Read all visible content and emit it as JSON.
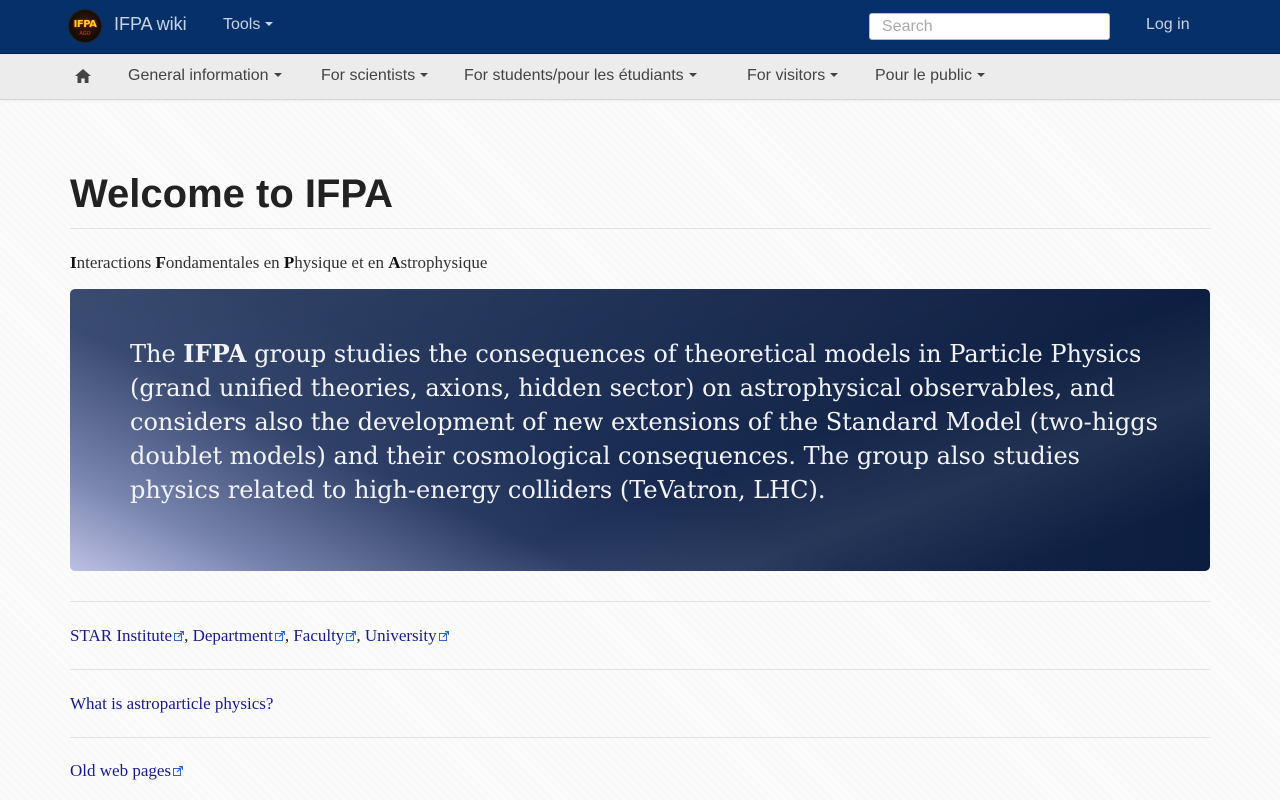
{
  "topbar": {
    "logo_text": "IFPA",
    "logo_sub": "AGO",
    "brand": "IFPA wiki",
    "tools_label": "Tools",
    "search_placeholder": "Search",
    "login_label": "Log in",
    "color": "#06306a"
  },
  "subnav": {
    "home_icon": "home-icon",
    "items": [
      {
        "label": "General information"
      },
      {
        "label": "For scientists"
      },
      {
        "label": "For students/pour les étudiants"
      },
      {
        "label": "For visitors"
      },
      {
        "label": "Pour le public"
      }
    ]
  },
  "page": {
    "title": "Welcome to IFPA",
    "subtitle": [
      {
        "initial": "I",
        "rest": "nteractions "
      },
      {
        "initial": "F",
        "rest": "ondamentales en "
      },
      {
        "initial": "P",
        "rest": "hysique et en "
      },
      {
        "initial": "A",
        "rest": "strophysique"
      }
    ],
    "hero": {
      "lead": "The ",
      "bold": "IFPA",
      "body": " group studies the consequences of theoretical models in Particle Physics (grand unified theories, axions, hidden sector) on astrophysical observables, and considers also the development of new extensions of the Standard Model (two-higgs doublet models) and their cosmological consequences. The group also studies physics related to high-energy colliders (TeVatron, LHC)."
    },
    "links": {
      "star": "STAR Institute",
      "department": "Department",
      "faculty": "Faculty",
      "university": "University",
      "separator": ",",
      "astroparticle": "What is astroparticle physics?",
      "old_pages": "Old web pages"
    },
    "link_color": "#1a1a8a"
  }
}
